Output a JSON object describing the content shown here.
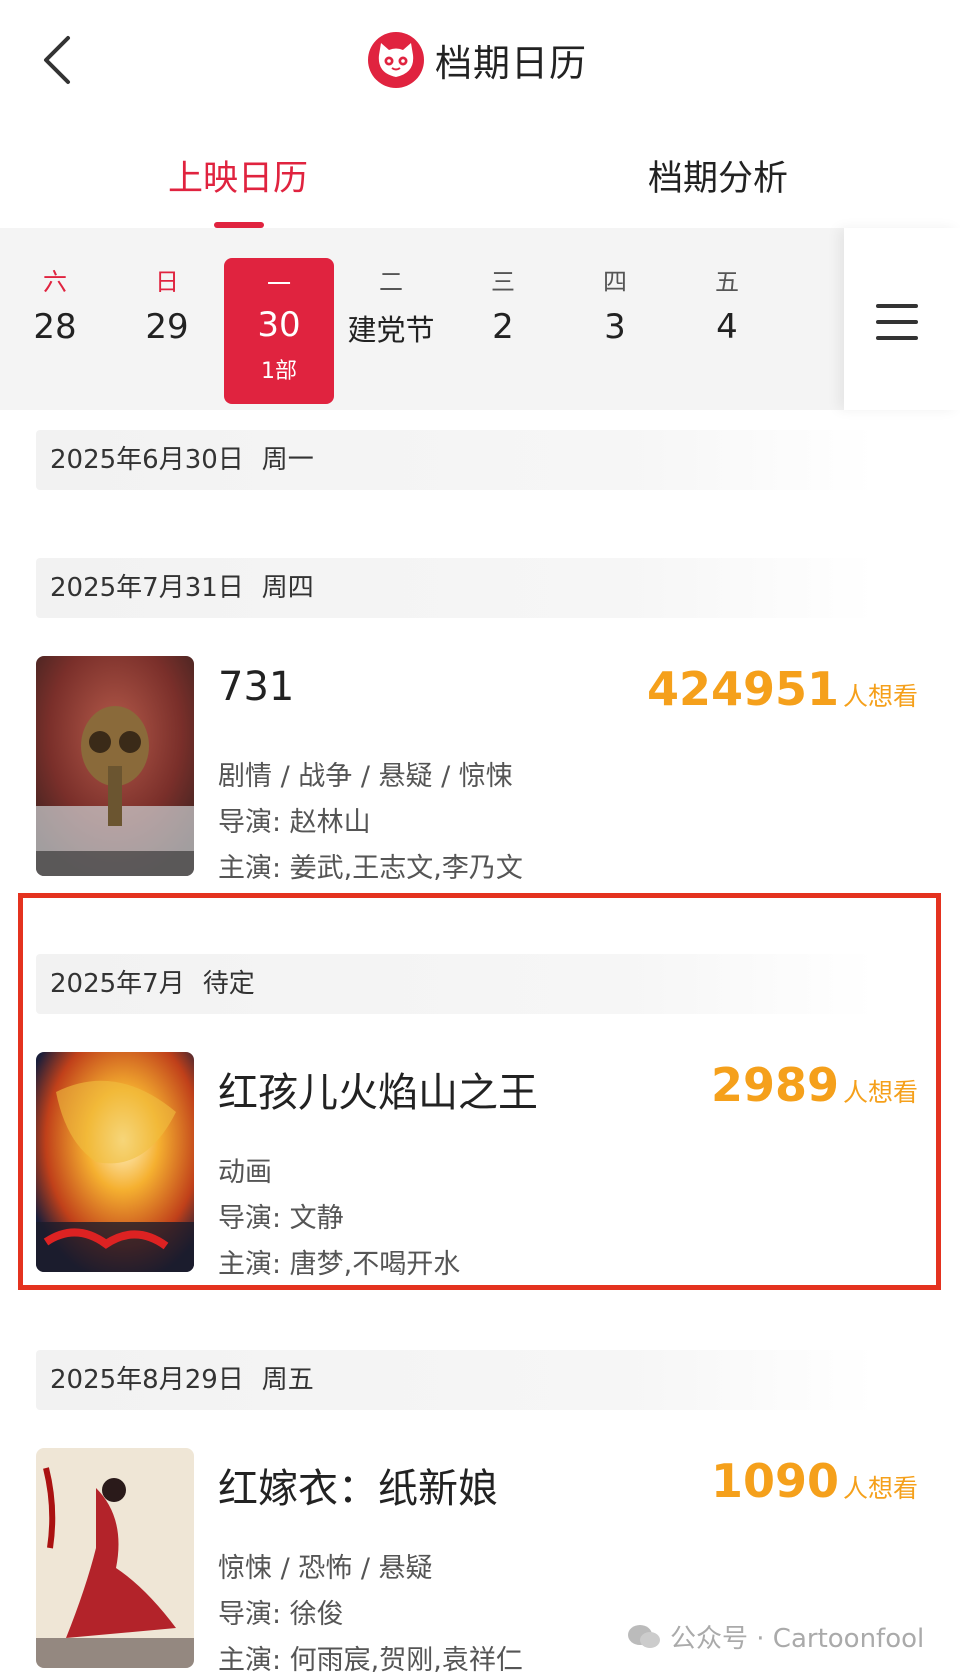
{
  "header": {
    "title": "档期日历",
    "back_icon": "chevron-left-icon",
    "logo_icon": "cat-logo-icon"
  },
  "tabs": [
    {
      "label": "上映日历",
      "active": true
    },
    {
      "label": "档期分析",
      "active": false
    }
  ],
  "date_strip": {
    "days": [
      {
        "weekday": "六",
        "number": "28",
        "weekend": true
      },
      {
        "weekday": "日",
        "number": "29",
        "weekend": true
      },
      {
        "weekday": "一",
        "number": "30",
        "count": "1部",
        "selected": true
      },
      {
        "weekday": "二",
        "number": "建党节"
      },
      {
        "weekday": "三",
        "number": "2"
      },
      {
        "weekday": "四",
        "number": "3"
      },
      {
        "weekday": "五",
        "number": "4"
      }
    ],
    "menu_icon": "menu-icon"
  },
  "groups": [
    {
      "date": "2025年6月30日",
      "week": "周一",
      "movies": []
    },
    {
      "date": "2025年7月31日",
      "week": "周四",
      "movies": [
        {
          "title": "731",
          "want_count": "424951",
          "want_unit": "人想看",
          "genres": "剧情 / 战争 / 悬疑 / 惊悚",
          "director": "导演: 赵林山",
          "cast": "主演: 姜武,王志文,李乃文"
        }
      ]
    },
    {
      "date": "2025年7月",
      "week": "待定",
      "movies": [
        {
          "title": "红孩儿火焰山之王",
          "want_count": "2989",
          "want_unit": "人想看",
          "genres": "动画",
          "director": "导演: 文静",
          "cast": "主演: 唐梦,不喝开水"
        }
      ]
    },
    {
      "date": "2025年8月29日",
      "week": "周五",
      "movies": [
        {
          "title": "红嫁衣：纸新娘",
          "want_count": "1090",
          "want_unit": "人想看",
          "genres": "惊悚 / 恐怖 / 悬疑",
          "director": "导演: 徐俊",
          "cast": "主演: 何雨宸,贺刚,袁祥仁"
        }
      ]
    }
  ],
  "watermark": {
    "text": "公众号 · Cartoonfool"
  },
  "colors": {
    "accent": "#e0233f",
    "want": "#f5a01b",
    "highlight_border": "#e4321f"
  }
}
